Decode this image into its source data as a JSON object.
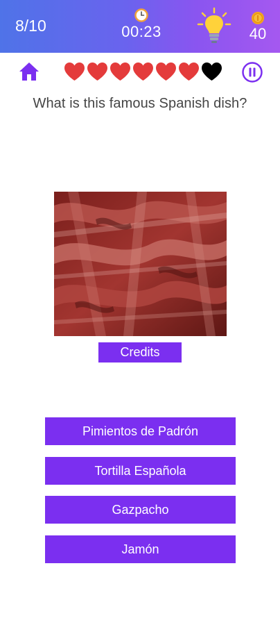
{
  "header": {
    "progress": "8/10",
    "timer": "00:23",
    "coins": "40",
    "clock_icon": "clock-icon",
    "hint_icon": "lightbulb-icon",
    "coin_icon": "coin-icon"
  },
  "status": {
    "home_icon": "home-icon",
    "lives_total": 7,
    "lives_remaining": 6,
    "pause_icon": "pause-icon"
  },
  "question": {
    "text": "What is this famous Spanish dish?"
  },
  "image": {
    "subject": "thin slices of cured ham"
  },
  "credits_label": "Credits",
  "answers": [
    "Pimientos de Padrón",
    "Tortilla Española",
    "Gazpacho",
    "Jamón"
  ],
  "colors": {
    "accent": "#7b2ff0",
    "heart_full": "#e43b3b",
    "heart_lost": "#000000",
    "header_gradient_start": "#4f73e8",
    "header_gradient_end": "#a558f0"
  }
}
